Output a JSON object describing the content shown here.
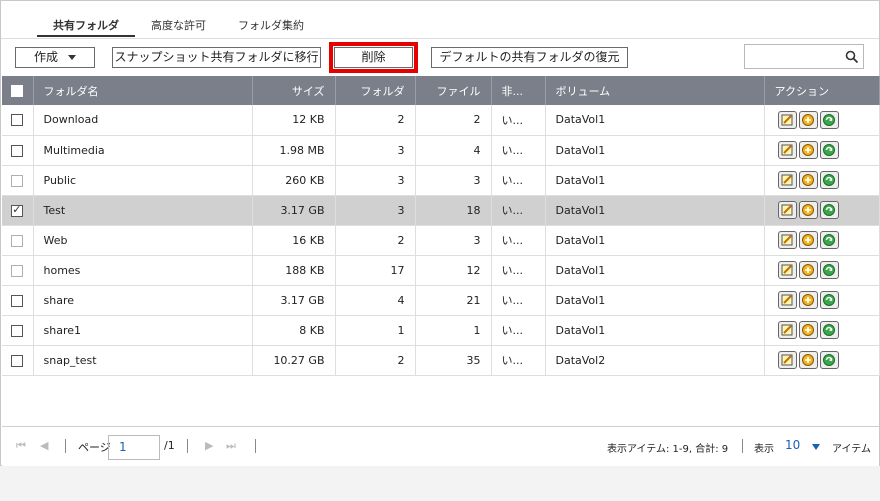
{
  "tabs": [
    {
      "label": "共有フォルダ",
      "active": true
    },
    {
      "label": "高度な許可",
      "active": false
    },
    {
      "label": "フォルダ集約",
      "active": false
    }
  ],
  "toolbar": {
    "create_label": "作成",
    "migrate_label": "スナップショット共有フォルダに移行",
    "delete_label": "削除",
    "restore_label": "デフォルトの共有フォルダの復元",
    "search_placeholder": ""
  },
  "table": {
    "headers": {
      "name": "フォルダ名",
      "size": "サイズ",
      "folders": "フォルダ",
      "files": "ファイル",
      "hidden": "非...",
      "volume": "ボリューム",
      "actions": "アクション"
    },
    "rows": [
      {
        "name": "Download",
        "size": "12 KB",
        "folders": "2",
        "files": "2",
        "hidden": "い...",
        "volume": "DataVol1"
      },
      {
        "name": "Multimedia",
        "size": "1.98 MB",
        "folders": "3",
        "files": "4",
        "hidden": "い...",
        "volume": "DataVol1"
      },
      {
        "name": "Public",
        "size": "260 KB",
        "folders": "3",
        "files": "3",
        "hidden": "い...",
        "volume": "DataVol1"
      },
      {
        "name": "Test",
        "size": "3.17 GB",
        "folders": "3",
        "files": "18",
        "hidden": "い...",
        "volume": "DataVol1"
      },
      {
        "name": "Web",
        "size": "16 KB",
        "folders": "2",
        "files": "3",
        "hidden": "い...",
        "volume": "DataVol1"
      },
      {
        "name": "homes",
        "size": "188 KB",
        "folders": "17",
        "files": "12",
        "hidden": "い...",
        "volume": "DataVol1"
      },
      {
        "name": "share",
        "size": "3.17 GB",
        "folders": "4",
        "files": "21",
        "hidden": "い...",
        "volume": "DataVol1"
      },
      {
        "name": "share1",
        "size": "8 KB",
        "folders": "1",
        "files": "1",
        "hidden": "い...",
        "volume": "DataVol1"
      },
      {
        "name": "snap_test",
        "size": "10.27 GB",
        "folders": "2",
        "files": "35",
        "hidden": "い...",
        "volume": "DataVol2"
      }
    ]
  },
  "pager": {
    "page_label": "ページ",
    "page_value": "1",
    "page_total": "/1",
    "info": "表示アイテム: 1-9, 合計: 9",
    "show_label": "表示",
    "per_page": "10",
    "items_label": "アイテム"
  },
  "colors": {
    "header_bg": "#7b7f8a",
    "selected_row": "#d0d0d0",
    "highlight": "#e60000",
    "accent": "#1a5fb4"
  }
}
